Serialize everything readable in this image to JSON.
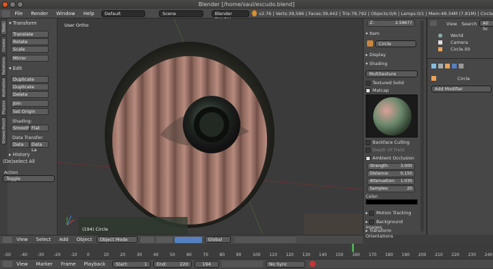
{
  "window": {
    "title": "Blender [/home/saul/escudo.blend]"
  },
  "menu": {
    "items": [
      "File",
      "Render",
      "Window",
      "Help"
    ],
    "layout": "Default",
    "scene": "Scene",
    "engine": "Blender Render",
    "stats": "v2.76 | Verts:39,586 | Faces:39,442 | Tris:78,792 | Objects:0/6 | Lamps:0/1 | Mem:48.34M (7.81M) | Circle"
  },
  "toolshelf": {
    "tabs": [
      "Tools",
      "Create",
      "Relations",
      "Animation",
      "Physics",
      "Grease Pencil"
    ],
    "transform_header": "Transform",
    "translate": "Translate",
    "rotate": "Rotate",
    "scale": "Scale",
    "mirror": "Mirror",
    "edit_header": "Edit",
    "duplicate": "Duplicate",
    "duplicate_linked": "Duplicate Linked",
    "delete": "Delete",
    "join": "Join",
    "set_origin": "Set Origin",
    "shading_label": "Shading:",
    "smooth": "Smooth",
    "flat": "Flat",
    "data_transfer_label": "Data Transfer:",
    "data": "Data",
    "data_la": "Data La",
    "history_header": "History",
    "deselect_all": "(De)select All",
    "action_label": "Action",
    "action_value": "Toggle"
  },
  "viewport": {
    "view_name": "User Ortho",
    "object_label": "(194) Circle"
  },
  "props": {
    "z_label": "Z:",
    "z_value": "2.59677",
    "item_header": "Item",
    "item_name": "Circle",
    "display_header": "Display",
    "shading_header": "Shading",
    "mode": "Multitexture",
    "textured_solid": "Textured Solid",
    "matcap": "Matcap",
    "backface": "Backface Culling",
    "depth": "Depth Of Field",
    "ao": "Ambient Occlusion",
    "ao_fields": [
      {
        "k": "Strength:",
        "v": "3.000"
      },
      {
        "k": "Distance:",
        "v": "0.150"
      },
      {
        "k": "Attenuation:",
        "v": "1.030"
      },
      {
        "k": "Samples:",
        "v": "20"
      }
    ],
    "color_label": "Color:",
    "motion": "Motion Tracking",
    "bg_images": "Background Images",
    "transform_orient": "Transform Orientations"
  },
  "outliner": {
    "view": "View",
    "search": "Search",
    "all_scenes": "All Sc",
    "world": "World",
    "camera": "Camera",
    "circle": "Circle.00",
    "obj": "Circle",
    "add_modifier": "Add Modifier"
  },
  "vpheader": {
    "view": "View",
    "select": "Select",
    "add": "Add",
    "object": "Object",
    "mode": "Object Mode",
    "orient": "Global"
  },
  "timeline": {
    "ticks": [
      "-50",
      "-40",
      "-30",
      "-20",
      "-10",
      "0",
      "10",
      "20",
      "30",
      "40",
      "50",
      "60",
      "70",
      "80",
      "90",
      "100",
      "110",
      "120",
      "130",
      "140",
      "150",
      "160",
      "170",
      "180",
      "190",
      "200",
      "210",
      "220",
      "230",
      "240"
    ],
    "view": "View",
    "marker": "Marker",
    "frame": "Frame",
    "playback": "Playback",
    "start": "Start:",
    "start_v": "1",
    "end": "End:",
    "end_v": "220",
    "current": "194",
    "sync": "No Sync"
  },
  "colors": {
    "accent": "#5680c2",
    "bg": "#3d3d3d"
  }
}
